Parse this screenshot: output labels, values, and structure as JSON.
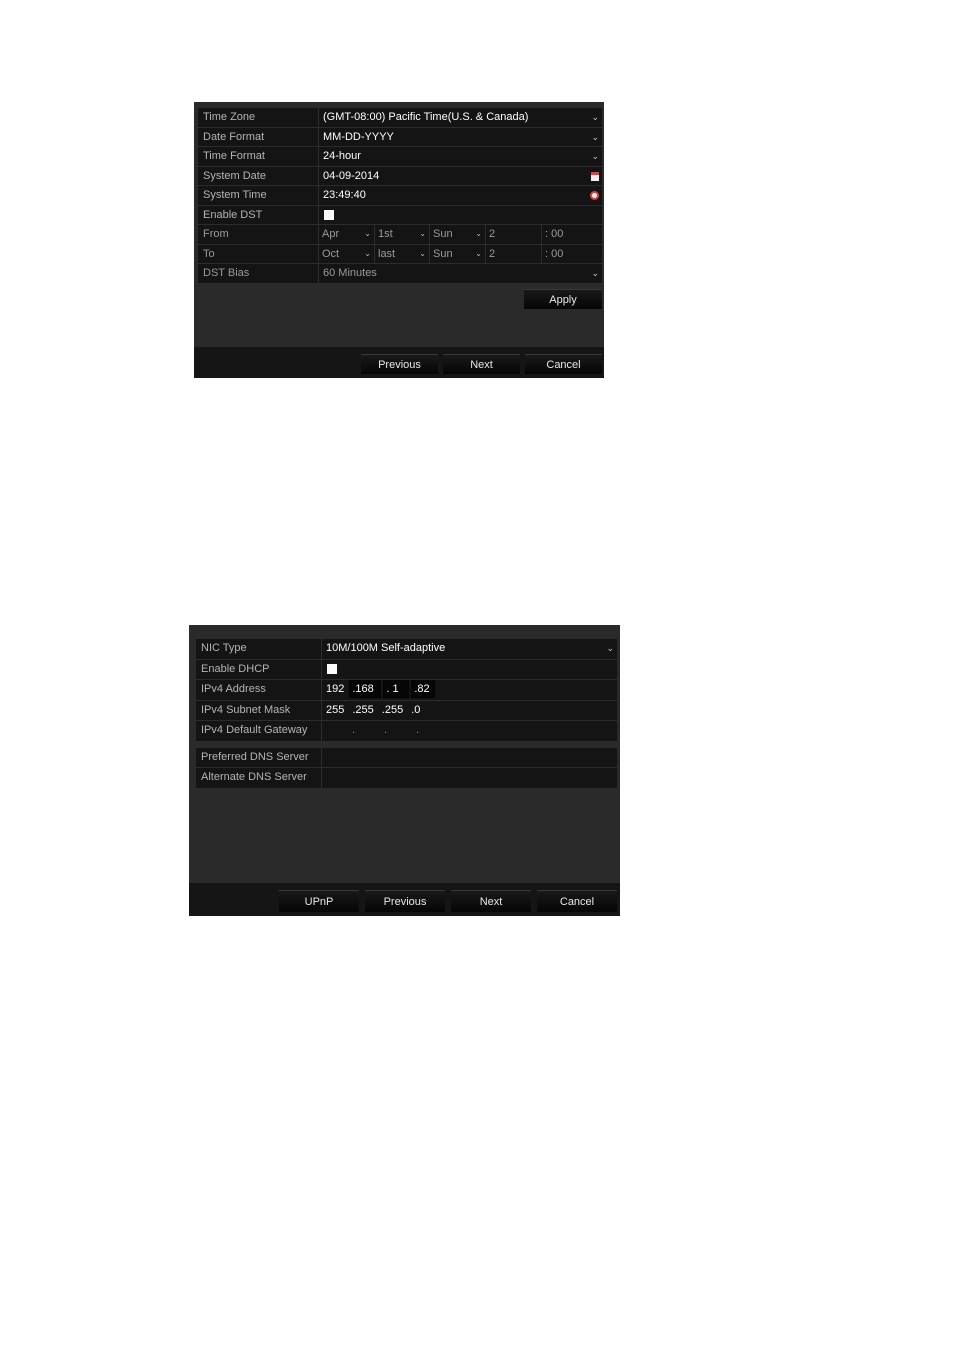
{
  "datetime_panel": {
    "rows": {
      "time_zone": {
        "label": "Time Zone",
        "value": "(GMT-08:00) Pacific Time(U.S. & Canada)"
      },
      "date_format": {
        "label": "Date Format",
        "value": "MM-DD-YYYY"
      },
      "time_format": {
        "label": "Time Format",
        "value": "24-hour"
      },
      "system_date": {
        "label": "System Date",
        "value": "04-09-2014",
        "icon": "calendar-icon"
      },
      "system_time": {
        "label": "System Time",
        "value": "23:49:40",
        "icon": "clock-icon"
      },
      "enable_dst": {
        "label": "Enable DST",
        "checked": false
      },
      "from": {
        "label": "From",
        "month": "Apr",
        "week": "1st",
        "day": "Sun",
        "hour": "2",
        "minute": ": 00"
      },
      "to": {
        "label": "To",
        "month": "Oct",
        "week": "last",
        "day": "Sun",
        "hour": "2",
        "minute": ": 00"
      },
      "dst_bias": {
        "label": "DST Bias",
        "value": "60 Minutes"
      }
    },
    "buttons": {
      "apply": "Apply",
      "previous": "Previous",
      "next": "Next",
      "cancel": "Cancel"
    }
  },
  "network_panel": {
    "rows": {
      "nic_type": {
        "label": "NIC Type",
        "value": "10M/100M Self-adaptive"
      },
      "enable_dhcp": {
        "label": "Enable DHCP",
        "checked": false
      },
      "ipv4_address": {
        "label": "IPv4 Address",
        "octets": [
          "192",
          ".168",
          ". 1",
          ".82"
        ]
      },
      "subnet_mask": {
        "label": "IPv4 Subnet Mask",
        "octets": [
          "255",
          ".255",
          ".255",
          ".0"
        ]
      },
      "default_gateway": {
        "label": "IPv4 Default Gateway",
        "octets": [
          "",
          ".",
          ".",
          "."
        ]
      },
      "preferred_dns": {
        "label": "Preferred DNS Server",
        "value": ""
      },
      "alternate_dns": {
        "label": "Alternate DNS Server",
        "value": ""
      }
    },
    "buttons": {
      "upnp": "UPnP",
      "previous": "Previous",
      "next": "Next",
      "cancel": "Cancel"
    }
  }
}
